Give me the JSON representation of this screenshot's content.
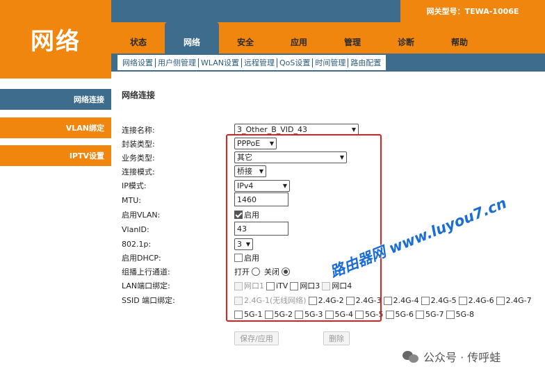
{
  "header": {
    "logo": "网络",
    "model": "网关型号：TEWA-1006E",
    "tabs": [
      {
        "label": "状态",
        "active": false
      },
      {
        "label": "网络",
        "active": true
      },
      {
        "label": "安全",
        "active": false
      },
      {
        "label": "应用",
        "active": false
      },
      {
        "label": "管理",
        "active": false
      },
      {
        "label": "诊断",
        "active": false
      },
      {
        "label": "帮助",
        "active": false
      }
    ],
    "subnav": [
      "网络设置",
      "用户侧管理",
      "WLAN设置",
      "远程管理",
      "QoS设置",
      "时间管理",
      "路由配置"
    ]
  },
  "sidebar": {
    "items": [
      {
        "label": "网络连接",
        "active": true
      },
      {
        "label": "VLAN绑定",
        "active": false
      },
      {
        "label": "IPTV设置",
        "active": false
      }
    ]
  },
  "main": {
    "title": "网络连接",
    "labels": {
      "conn_name": "连接名称:",
      "encap": "封装类型:",
      "service": "业务类型:",
      "mode": "连接模式:",
      "ip_mode": "IP模式:",
      "mtu": "MTU:",
      "vlan_enable": "启用VLAN:",
      "vlan_id": "VlanID:",
      "dot1p": "802.1p:",
      "dhcp": "启用DHCP:",
      "multicast": "组播上行通道:",
      "lan_bind": "LAN端口绑定:",
      "ssid_bind": "SSID 端口绑定:"
    },
    "values": {
      "conn_name": "3_Other_B_VID_43",
      "encap": "PPPoE",
      "service": "其它",
      "mode": "桥接",
      "ip_mode": "IPv4",
      "mtu": "1460",
      "vlan_enable_label": "启用",
      "vlan_enable_checked": true,
      "vlan_id": "43",
      "dot1p": "3",
      "dhcp_label": "启用",
      "dhcp_checked": false,
      "multicast_on": "打开",
      "multicast_off": "关闭",
      "multicast_selected": "关闭"
    },
    "lan_ports": [
      "网口1",
      "iTV",
      "网口3",
      "网口4"
    ],
    "ssid_row1": [
      "2.4G-1(无线网络)",
      "2.4G-2",
      "2.4G-3",
      "2.4G-4",
      "2.4G-5",
      "2.4G-6",
      "2.4G-7"
    ],
    "ssid_row2": [
      "5G-1",
      "5G-2",
      "5G-3",
      "5G-4",
      "5G-5",
      "5G-6",
      "5G-7",
      "5G-8"
    ],
    "buttons": {
      "save": "保存/应用",
      "delete": "删除"
    }
  },
  "overlay": {
    "watermark": "路由器网 www.luyou7.cn",
    "wechat": "公众号 · 传呼蛙"
  },
  "colors": {
    "orange": "#f1860e",
    "blue": "#3d6c8c",
    "highlight": "#e02020",
    "watermark": "#1a6dd6"
  }
}
